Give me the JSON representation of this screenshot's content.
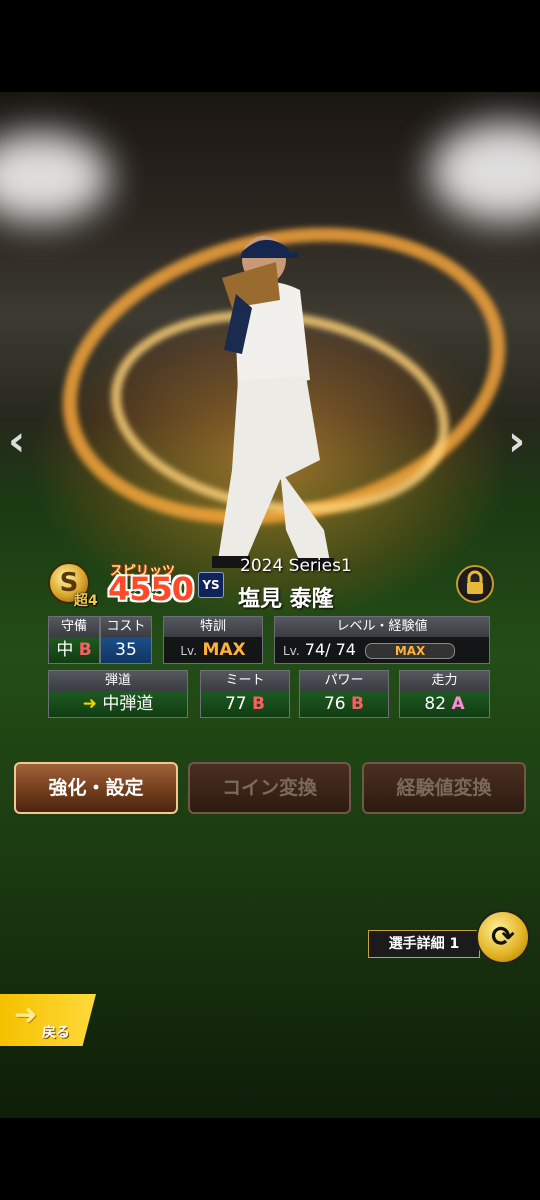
{
  "nav": {
    "prev_icon": "‹",
    "next_icon": "›"
  },
  "card": {
    "rarity": "S",
    "rarity_tag": "超4",
    "spirit_label": "スピリッツ",
    "spirit_value": "4550",
    "team_logo": "YS",
    "series": "2024 Series1",
    "player_name": "塩見 泰隆"
  },
  "stats": {
    "defense": {
      "header": "守備",
      "position": "中",
      "grade": "B"
    },
    "cost": {
      "header": "コスト",
      "value": "35"
    },
    "training": {
      "header": "特訓",
      "prefix": "Lv.",
      "value": "MAX"
    },
    "level": {
      "header": "レベル・経験値",
      "prefix": "Lv.",
      "current": "74",
      "separator": "/",
      "max": "74",
      "exp_label": "MAX",
      "exp_fill": 1.0
    },
    "trajectory": {
      "header": "弾道",
      "value": "中弾道"
    },
    "contact": {
      "header": "ミート",
      "value": "77",
      "grade": "B"
    },
    "power": {
      "header": "パワー",
      "value": "76",
      "grade": "B"
    },
    "speed": {
      "header": "走力",
      "value": "82",
      "grade": "A"
    }
  },
  "buttons": {
    "enhance": "強化・設定",
    "coin": "コイン変換",
    "exp": "経験値変換"
  },
  "detail": {
    "label": "選手詳細 1",
    "swap_icon": "⟳"
  },
  "back": {
    "label": "戻る",
    "icon": "➜"
  },
  "colors": {
    "grade_b": "#ff5c66",
    "grade_a": "#ff8ad8",
    "max": "#ffb13a",
    "back": "#f5c000"
  }
}
